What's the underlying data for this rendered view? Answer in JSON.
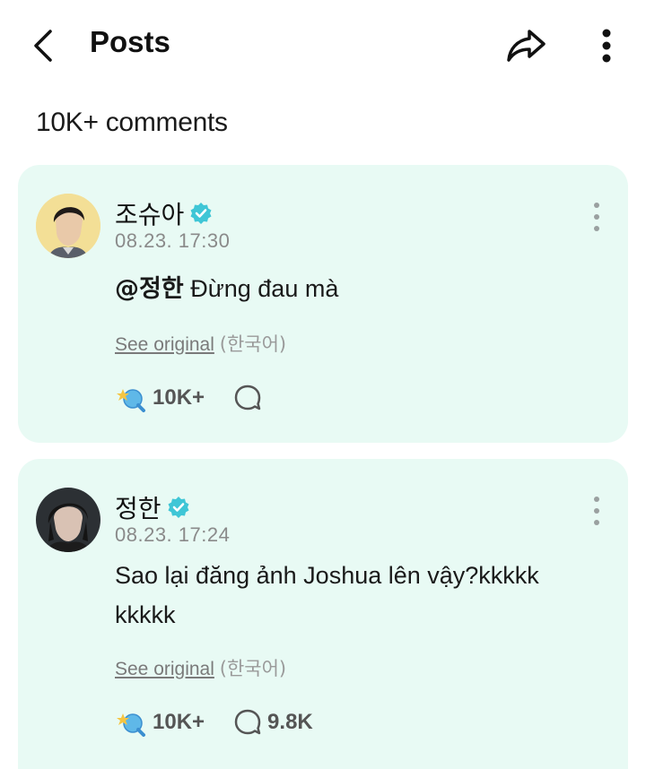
{
  "header": {
    "title": "Posts"
  },
  "comments_header": {
    "count_label": "10K+ comments"
  },
  "comments": [
    {
      "author": "조슈아",
      "timestamp": "08.23. 17:30",
      "mention": "@정한",
      "text": " Đừng đau mà",
      "see_original": "See original",
      "language": "(한국어)",
      "likes": "10K+",
      "replies": ""
    },
    {
      "author": "정한",
      "timestamp": "08.23. 17:24",
      "mention": "",
      "text": "Sao lại đăng ảnh Joshua lên vậy?kkkkk kkkkk",
      "see_original": "See original",
      "language": "(한국어)",
      "likes": "10K+",
      "replies": "9.8K"
    }
  ],
  "colors": {
    "card_background": "#e8faf4",
    "verified_badge": "#3fc6d6",
    "muted_text": "#8a8a8a"
  },
  "icons": [
    "back-arrow-icon",
    "share-icon",
    "more-vertical-icon",
    "verified-badge-icon",
    "cheer-icon",
    "reply-bubble-icon",
    "kebab-icon"
  ]
}
